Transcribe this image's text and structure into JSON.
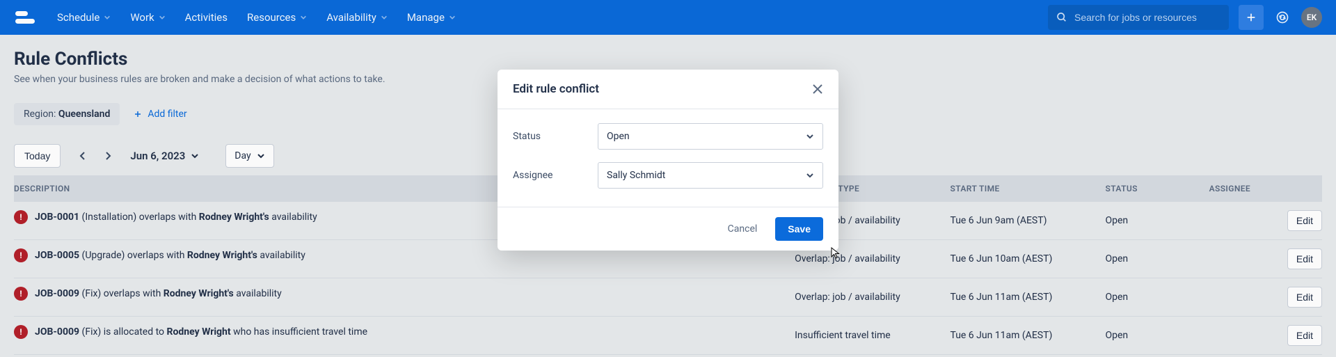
{
  "colors": {
    "primary": "#0b6bdb",
    "header_bg": "#0b6bdb"
  },
  "topbar": {
    "nav": [
      "Schedule",
      "Work",
      "Activities",
      "Resources",
      "Availability",
      "Manage"
    ],
    "nav_has_dropdown": [
      true,
      true,
      false,
      true,
      true,
      true
    ],
    "search_placeholder": "Search for jobs or resources",
    "avatar_initials": "EK"
  },
  "page": {
    "title": "Rule Conflicts",
    "subtitle": "See when your business rules are broken and make a decision of what actions to take."
  },
  "filters": {
    "region_label": "Region:",
    "region_value": "Queensland",
    "add_filter_label": "Add filter"
  },
  "toolbar": {
    "today_label": "Today",
    "date_label": "Jun 6, 2023",
    "granularity_label": "Day"
  },
  "table": {
    "columns": {
      "description": "DESCRIPTION",
      "conflict_type": "CONFLICT TYPE",
      "start_time": "START TIME",
      "status": "STATUS",
      "assignee": "ASSIGNEE"
    },
    "edit_label": "Edit",
    "rows": [
      {
        "job_id": "JOB-0001",
        "desc_prefix": "(Installation) overlaps with",
        "actor": "Rodney Wright's",
        "desc_suffix": "availability",
        "conflict_type": "Overlap: job / availability",
        "start_time": "Tue 6 Jun 9am (AEST)",
        "status": "Open",
        "assignee": ""
      },
      {
        "job_id": "JOB-0005",
        "desc_prefix": "(Upgrade) overlaps with",
        "actor": "Rodney Wright's",
        "desc_suffix": "availability",
        "conflict_type": "Overlap: job / availability",
        "start_time": "Tue 6 Jun 10am (AEST)",
        "status": "Open",
        "assignee": ""
      },
      {
        "job_id": "JOB-0009",
        "desc_prefix": "(Fix) overlaps with",
        "actor": "Rodney Wright's",
        "desc_suffix": "availability",
        "conflict_type": "Overlap: job / availability",
        "start_time": "Tue 6 Jun 11am (AEST)",
        "status": "Open",
        "assignee": ""
      },
      {
        "job_id": "JOB-0009",
        "desc_prefix": "(Fix) is allocated to",
        "actor": "Rodney Wright",
        "desc_suffix": "who has insufficient travel time",
        "conflict_type": "Insufficient travel time",
        "start_time": "Tue 6 Jun 11am (AEST)",
        "status": "Open",
        "assignee": ""
      }
    ]
  },
  "modal": {
    "title": "Edit rule conflict",
    "status_label": "Status",
    "status_value": "Open",
    "assignee_label": "Assignee",
    "assignee_value": "Sally Schmidt",
    "cancel_label": "Cancel",
    "save_label": "Save"
  }
}
